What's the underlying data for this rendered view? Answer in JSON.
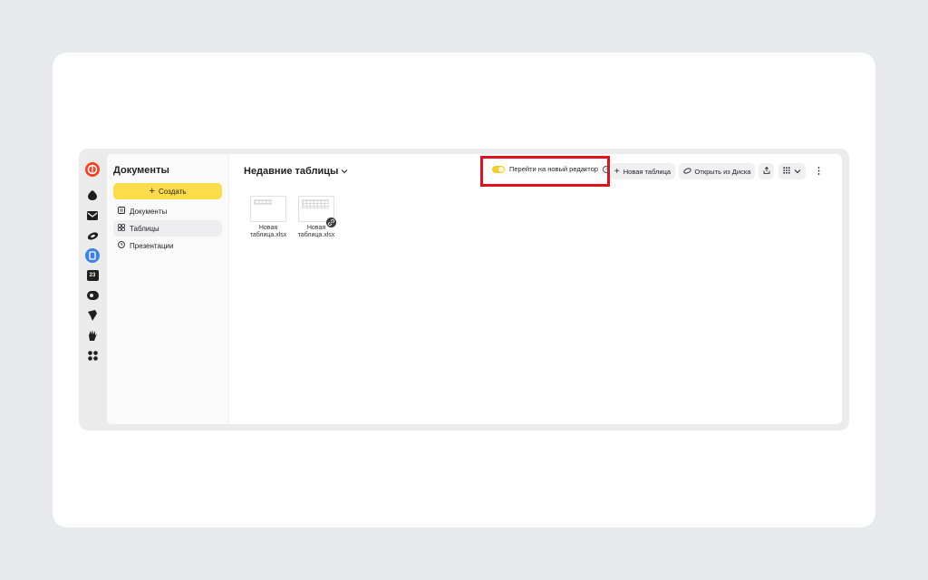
{
  "sidebar": {
    "title": "Документы",
    "create_label": "Создать",
    "items": [
      {
        "label": "Документы"
      },
      {
        "label": "Таблицы"
      },
      {
        "label": "Презентации"
      }
    ]
  },
  "main": {
    "title": "Недавние таблицы",
    "toggle_label": "Перейти на новый редактор",
    "new_table_label": "Новая таблица",
    "open_disk_label": "Открыть из Диска"
  },
  "files": [
    {
      "name_line1": "Новая",
      "name_line2": "таблица.xlsx"
    },
    {
      "name_line1": "Новая",
      "name_line2": "таблица.xlsx"
    }
  ],
  "rail": {
    "calendar_day": "23"
  },
  "colors": {
    "accent_yellow": "#fddc4c",
    "highlight_red": "#e5101a",
    "active_blue": "#3b82e6",
    "brand_orange": "#fc3f1d"
  }
}
